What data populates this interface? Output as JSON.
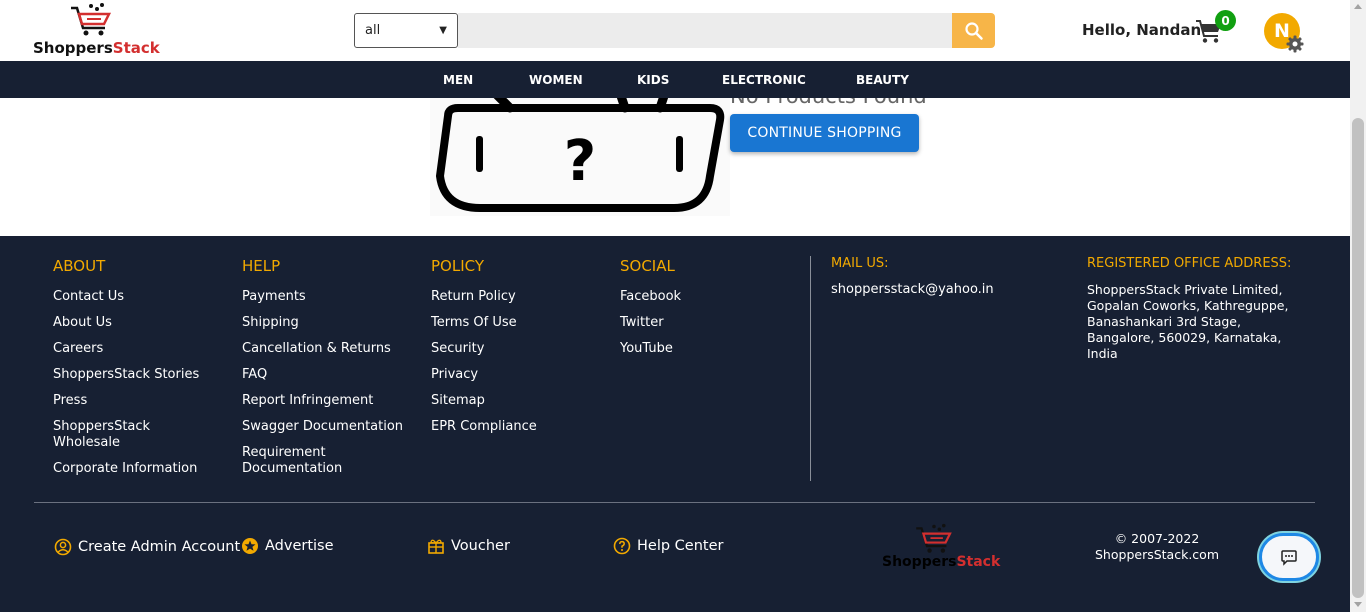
{
  "brand": {
    "name_part1": "Shoppers",
    "name_part2": "Stack",
    "accent_color": "#d32f2f"
  },
  "search": {
    "category_value": "all",
    "placeholder": ""
  },
  "user": {
    "greeting": "Hello, Nandan",
    "cart_count": "0",
    "avatar_initial": "N"
  },
  "nav": {
    "items": [
      "MEN",
      "WOMEN",
      "KIDS",
      "ELECTRONIC",
      "BEAUTY"
    ]
  },
  "main": {
    "message": "No Products Found",
    "continue_label": "CONTINUE SHOPPING"
  },
  "footer": {
    "about": {
      "title": "ABOUT",
      "links": [
        "Contact Us",
        "About Us",
        "Careers",
        "ShoppersStack Stories",
        "Press",
        "ShoppersStack Wholesale",
        "Corporate Information"
      ]
    },
    "help": {
      "title": "HELP",
      "links": [
        "Payments",
        "Shipping",
        "Cancellation & Returns",
        "FAQ",
        "Report Infringement",
        "Swagger Documentation",
        "Requirement Documentation"
      ]
    },
    "policy": {
      "title": "POLICY",
      "links": [
        "Return Policy",
        "Terms Of Use",
        "Security",
        "Privacy",
        "Sitemap",
        "EPR Compliance"
      ]
    },
    "social": {
      "title": "SOCIAL",
      "links": [
        "Facebook",
        "Twitter",
        "YouTube"
      ]
    },
    "mail": {
      "title": "MAIL US:",
      "value": "shoppersstack@yahoo.in"
    },
    "office": {
      "title": "REGISTERED OFFICE ADDRESS:",
      "address": "ShoppersStack Private Limited, Gopalan Coworks, Kathreguppe, Banashankari 3rd Stage, Bangalore, 560029, Karnataka, India"
    },
    "bottom": {
      "create_admin": "Create Admin Account",
      "advertise": "Advertise",
      "voucher": "Voucher",
      "help_center": "Help Center"
    },
    "copyright": "© 2007-2022 ShoppersStack.com"
  },
  "colors": {
    "nav_bg": "#172033",
    "footer_heading": "#f2a900",
    "primary_button": "#1976d2",
    "search_button": "#f7b548",
    "badge": "#11a011"
  },
  "icons": [
    "search-icon",
    "cart-icon",
    "gear-icon",
    "user-circle-icon",
    "star-icon",
    "gift-icon",
    "help-circle-icon",
    "chat-icon"
  ]
}
